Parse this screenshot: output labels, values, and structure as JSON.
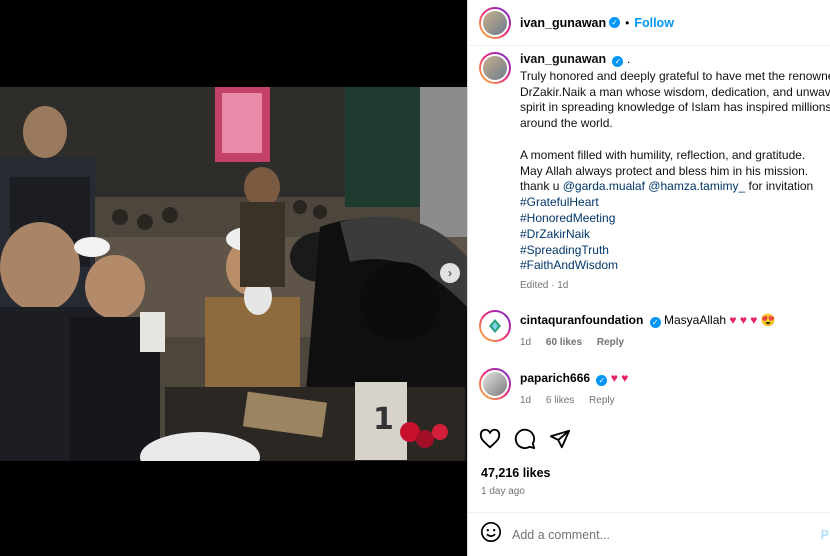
{
  "post": {
    "author": "ivan_gunawan",
    "follow_label": "Follow",
    "dot": "•"
  },
  "caption": {
    "author": "ivan_gunawan",
    "lines": [
      "Truly honored and deeply grateful to have met the renowned",
      "DrZakir.Naik a man whose wisdom, dedication, and unwavering",
      "spirit in spreading knowledge of Islam has inspired millions",
      "around the world.",
      "A moment filled with humility, reflection, and gratitude.",
      "May Allah always protect and bless him in his mission."
    ],
    "thanks_prefix": "thank u",
    "mentions": [
      "@garda.mualaf",
      "@hamza.tamimy_"
    ],
    "thanks_suffix": "for invitation",
    "hashtags": [
      "#GratefulHeart",
      "#HonoredMeeting",
      "#DrZakirNaik",
      "#SpreadingTruth",
      "#FaithAndWisdom"
    ],
    "edited": "Edited · 1d"
  },
  "comments": [
    {
      "user": "cintaquranfoundation",
      "text": "MasyaAllah",
      "emojis": "♥ ♥ ♥ 😍",
      "time": "1d",
      "likes": "60 likes",
      "reply": "Reply"
    },
    {
      "user": "paparich666",
      "text": "",
      "emojis": "♥ ♥",
      "time": "1d",
      "likes": "6 likes",
      "reply": "Reply"
    }
  ],
  "stats": {
    "likes": "47,216 likes",
    "time_ago": "1 day ago"
  },
  "composer": {
    "placeholder": "Add a comment...",
    "post_label": "P"
  },
  "colors": {
    "accent": "#0095f6",
    "link": "#00376b",
    "muted": "#737373",
    "heart": "#e8245f"
  }
}
